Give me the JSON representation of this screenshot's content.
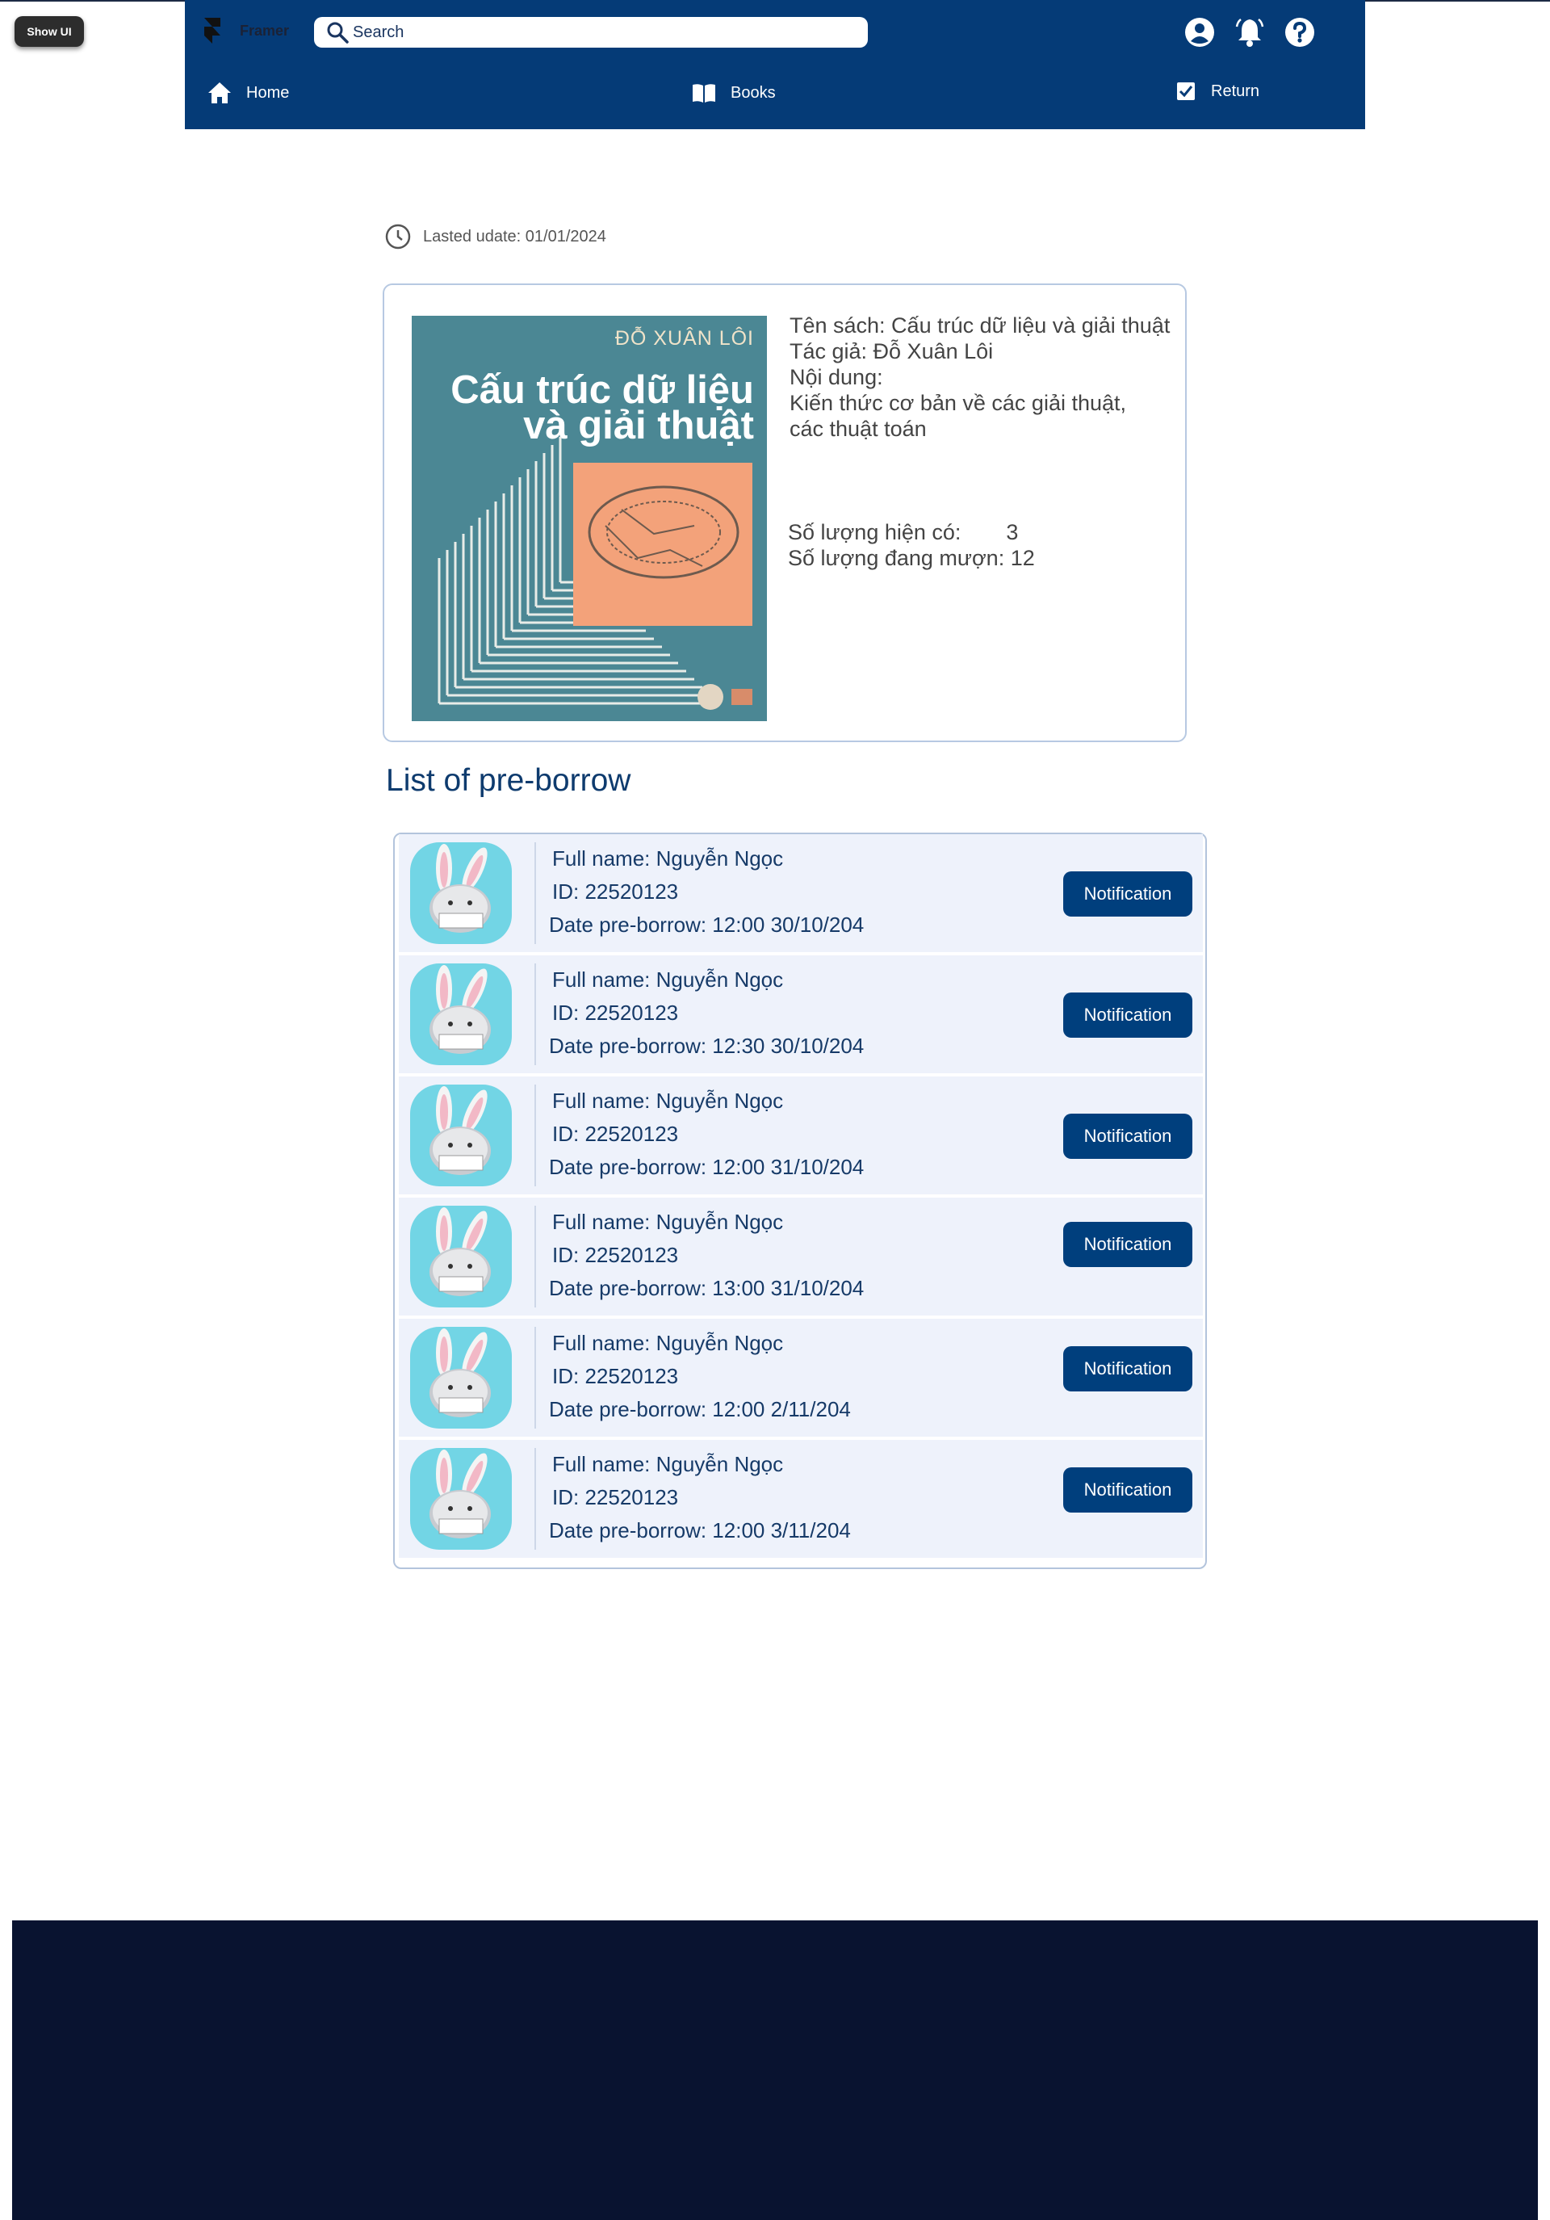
{
  "show_ui": {
    "label": "Show UI"
  },
  "header": {
    "brand": "Framer",
    "search_placeholder": "Search",
    "nav": [
      {
        "label": "Home",
        "icon": "home-icon"
      },
      {
        "label": "Books",
        "icon": "book-icon"
      },
      {
        "label": "Return",
        "icon": "return-icon"
      }
    ],
    "icons": [
      "user-icon",
      "bell-icon",
      "help-icon"
    ],
    "bg_color": "#053b77"
  },
  "updated": {
    "label": "Lasted udate: 01/01/2024"
  },
  "book": {
    "cover_author": "ĐỖ XUÂN LÔI",
    "cover_title_line1": "Cấu trúc dữ liệu",
    "cover_title_line2": "và giải thuật",
    "title_line": "Tên sách: Cấu trúc dữ liệu và giải thuật",
    "author_line": "Tác giả: Đỗ Xuân Lôi",
    "content_label": "Nội dung:",
    "content_line1": "Kiến thức cơ bản về các giải thuật,",
    "content_line2": "các thuật toán",
    "available_label": "Số lượng hiện có:",
    "available_value": "3",
    "borrowed_label": "Số lượng đang mượn:",
    "borrowed_value": "12"
  },
  "list": {
    "title": "List of pre-borrow",
    "items": [
      {
        "name": "Full name: Nguyễn Ngọc",
        "id": "ID: 22520123",
        "date": "Date pre-borrow: 12:00 30/10/204",
        "button": "Notification"
      },
      {
        "name": "Full name: Nguyễn Ngọc",
        "id": "ID: 22520123",
        "date": "Date pre-borrow: 12:30 30/10/204",
        "button": "Notification"
      },
      {
        "name": "Full name: Nguyễn Ngọc",
        "id": "ID: 22520123",
        "date": "Date pre-borrow: 12:00 31/10/204",
        "button": "Notification"
      },
      {
        "name": "Full name: Nguyễn Ngọc",
        "id": "ID: 22520123",
        "date": "Date pre-borrow: 13:00 31/10/204",
        "button": "Notification"
      },
      {
        "name": "Full name: Nguyễn Ngọc",
        "id": "ID: 22520123",
        "date": "Date pre-borrow: 12:00 2/11/204",
        "button": "Notification"
      },
      {
        "name": "Full name: Nguyễn Ngọc",
        "id": "ID: 22520123",
        "date": "Date pre-borrow: 12:00 3/11/204",
        "button": "Notification"
      }
    ]
  },
  "footer_color": "#091330"
}
